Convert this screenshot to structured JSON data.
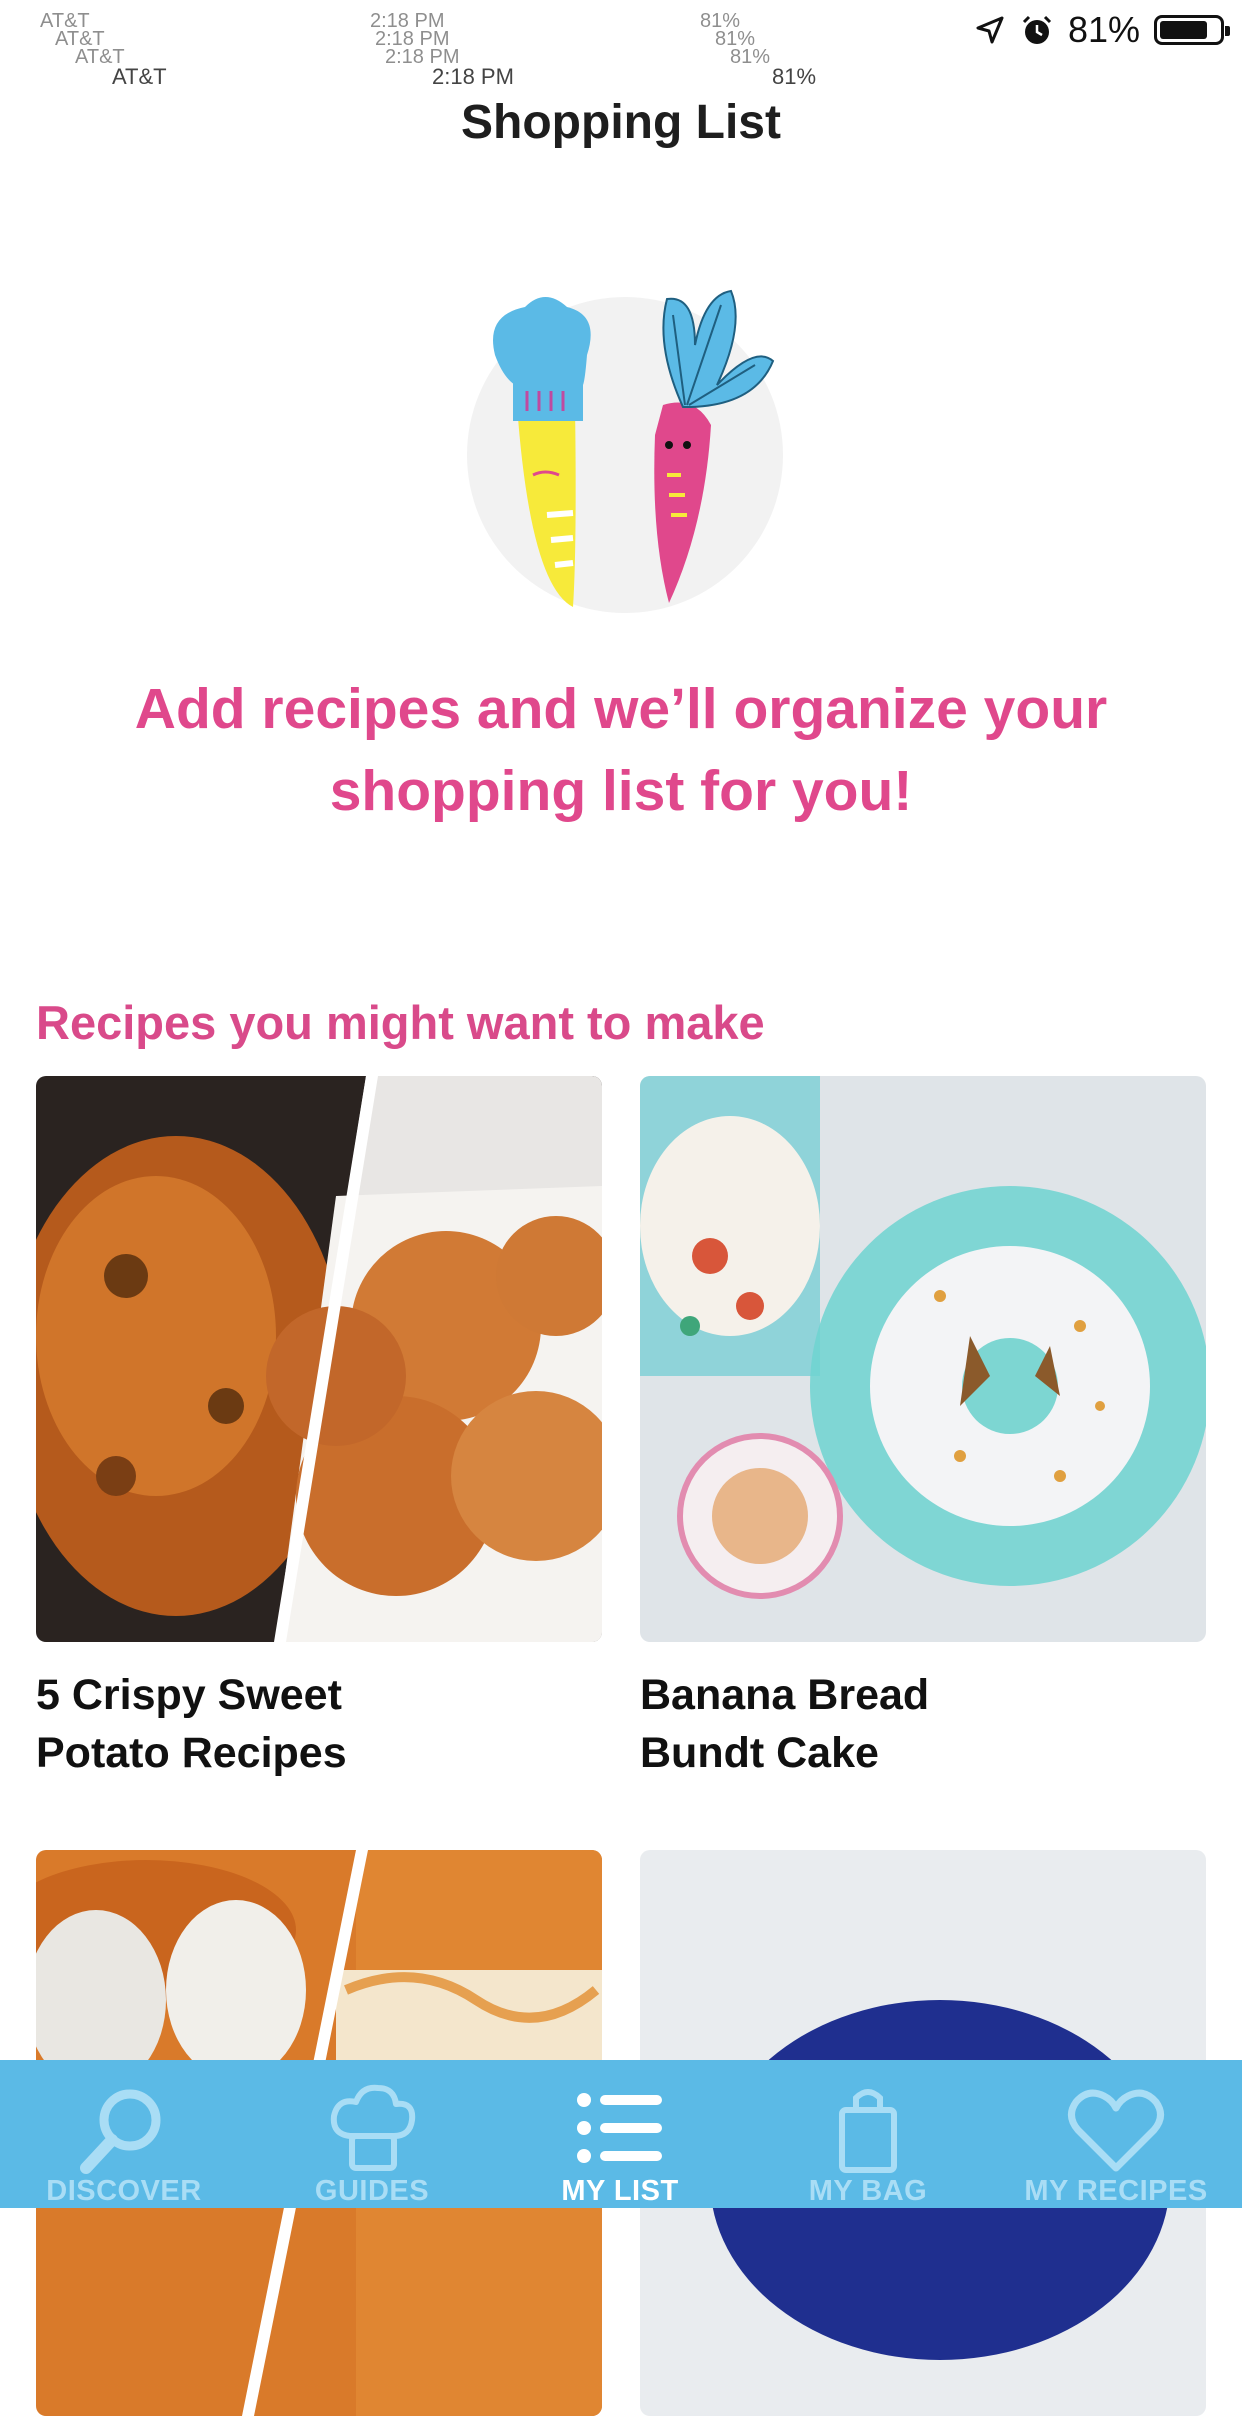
{
  "status_bar": {
    "carrier": "AT&T",
    "time": "2:18 PM",
    "battery_percent": "81%",
    "battery_level": 0.81
  },
  "header": {
    "title": "Shopping List"
  },
  "empty_state": {
    "message": "Add recipes and we’ll organize your shopping list for you!"
  },
  "recommendations": {
    "title": "Recipes you might want to make",
    "recipes": [
      {
        "title": "5 Crispy Sweet\nPotato Recipes"
      },
      {
        "title": "Banana Bread\nBundt Cake"
      },
      {
        "title": ""
      },
      {
        "title": ""
      }
    ]
  },
  "tab_bar": {
    "tabs": [
      {
        "label": "DISCOVER",
        "icon": "search-icon",
        "active": false
      },
      {
        "label": "GUIDES",
        "icon": "chef-hat-icon",
        "active": false
      },
      {
        "label": "MY LIST",
        "icon": "list-icon",
        "active": true
      },
      {
        "label": "MY BAG",
        "icon": "shopping-bag-icon",
        "active": false
      },
      {
        "label": "MY RECIPES",
        "icon": "heart-icon",
        "active": false
      }
    ]
  },
  "colors": {
    "accent_pink": "#e0488c",
    "tab_bar_bg": "#5bbae6",
    "tab_inactive": "#a9ddf5",
    "tab_active": "#ffffff"
  }
}
